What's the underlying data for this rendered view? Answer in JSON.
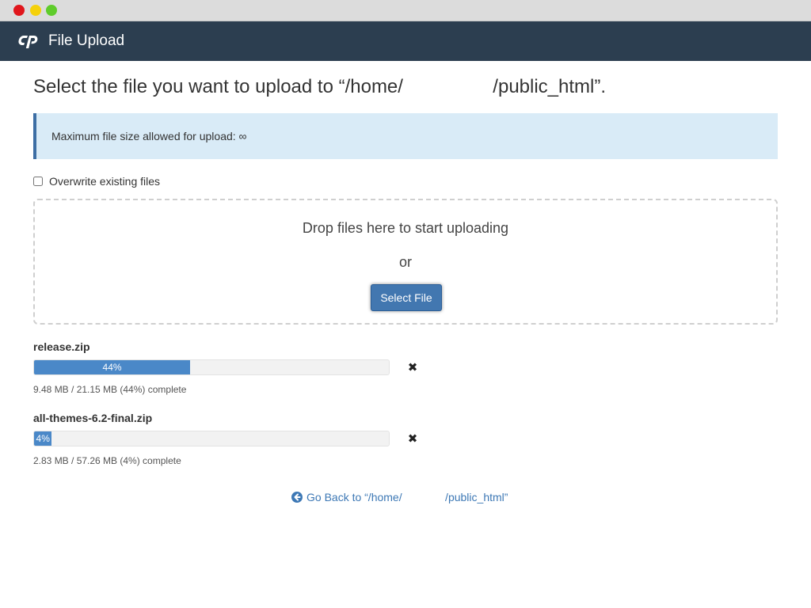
{
  "header": {
    "app_title": "File Upload",
    "logo_icon": "cpanel-logo"
  },
  "page": {
    "heading": "Select the file you want to upload to “/home/                 /public_html”."
  },
  "info": {
    "max_size_text": "Maximum file size allowed for upload: ∞"
  },
  "options": {
    "overwrite_label": "Overwrite existing files",
    "overwrite_checked": false
  },
  "dropzone": {
    "drop_text": "Drop files here to start uploading",
    "or_text": "or",
    "select_button_label": "Select File"
  },
  "uploads": [
    {
      "filename": "release.zip",
      "percent_label": "44%",
      "progress": 0.44,
      "status": "9.48 MB / 21.15 MB (44%) complete"
    },
    {
      "filename": "all-themes-6.2-final.zip",
      "percent_label": "4%",
      "progress": 0.04,
      "status": "2.83 MB / 57.26 MB (4%) complete"
    }
  ],
  "footer": {
    "go_back_text": "Go Back to “/home/              /public_html”"
  },
  "colors": {
    "header_bg": "#2c3e50",
    "info_bg": "#d9ebf7",
    "info_border": "#3d6ea4",
    "progress_fill": "#4a88c8",
    "button_bg": "#4277b0",
    "link": "#3d78b5"
  }
}
